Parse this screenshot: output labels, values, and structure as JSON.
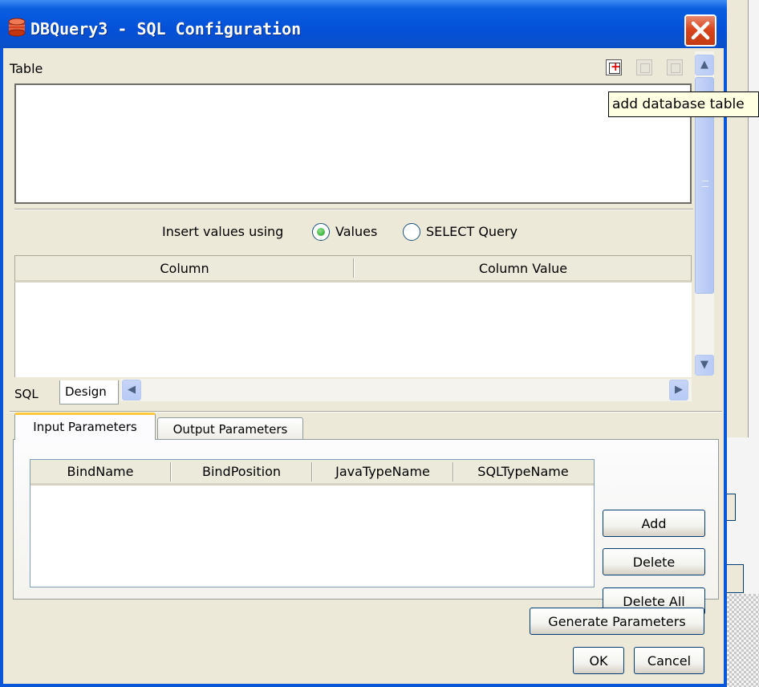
{
  "window": {
    "title": "DBQuery3 - SQL Configuration"
  },
  "table_section": {
    "label": "Table"
  },
  "toolbar": {
    "add_icon": "add-table-icon",
    "edit_icon": "edit-table-icon",
    "remove_icon": "remove-table-icon"
  },
  "tooltip": {
    "text": "add database table"
  },
  "insert": {
    "label": "Insert values using",
    "options": [
      {
        "label": "Values",
        "selected": true
      },
      {
        "label": "SELECT Query",
        "selected": false
      }
    ]
  },
  "column_grid": {
    "headers": [
      "Column",
      "Column Value"
    ]
  },
  "view_tabs": {
    "sql": "SQL",
    "design": "Design"
  },
  "param_tabs": {
    "input": "Input Parameters",
    "output": "Output Parameters"
  },
  "param_grid": {
    "headers": [
      "BindName",
      "BindPosition",
      "JavaTypeName",
      "SQLTypeName"
    ]
  },
  "param_buttons": {
    "add": "Add",
    "delete": "Delete",
    "delete_all": "Delete All"
  },
  "footer": {
    "generate": "Generate Parameters",
    "ok": "OK",
    "cancel": "Cancel"
  },
  "colors": {
    "titlebar": "#0451d8",
    "client": "#ece9d8",
    "tooltip_bg": "#ffffe1",
    "tab_accent": "#ffc83c"
  }
}
